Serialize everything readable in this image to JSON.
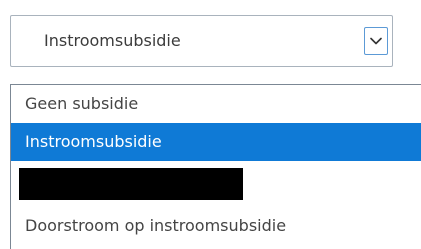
{
  "select": {
    "current_value": "Instroomsubsidie",
    "dropdown_icon": "chevron-down-icon"
  },
  "options": [
    {
      "label": "Geen subsidie",
      "selected": false,
      "redacted": false
    },
    {
      "label": "Instroomsubsidie",
      "selected": true,
      "redacted": false
    },
    {
      "label": "",
      "selected": false,
      "redacted": true
    },
    {
      "label": "Doorstroom op instroomsubsidie",
      "selected": false,
      "redacted": false
    }
  ],
  "colors": {
    "selected_background": "#0f7ad6",
    "selected_text": "#ffffff",
    "option_text": "#454545",
    "arrow_border": "#5c9ad6",
    "redaction": "#000000"
  }
}
